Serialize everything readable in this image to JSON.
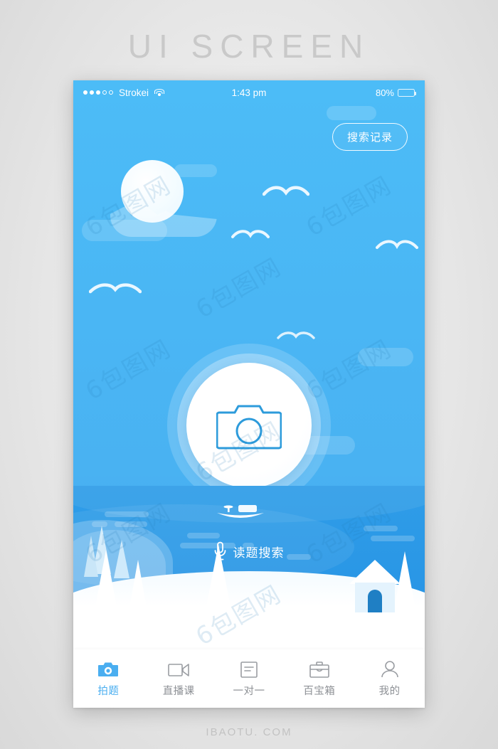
{
  "page": {
    "title": "UI  SCREEN",
    "footer": "IBAOTU. COM",
    "watermark": "6包图网"
  },
  "status_bar": {
    "carrier": "Strokei",
    "signal_filled": 3,
    "signal_hollow": 2,
    "time": "1:43 pm",
    "battery_percent": "80%",
    "battery_level": 80,
    "wifi_icon": "wifi-icon"
  },
  "header": {
    "search_history_label": "搜索记录"
  },
  "main": {
    "camera_button_icon": "camera-icon",
    "voice_search_label": "读题搜索",
    "voice_icon": "microphone-icon"
  },
  "tabbar": {
    "items": [
      {
        "label": "拍题",
        "icon": "camera-icon",
        "active": true
      },
      {
        "label": "直播课",
        "icon": "video-icon",
        "active": false
      },
      {
        "label": "一对一",
        "icon": "document-icon",
        "active": false
      },
      {
        "label": "百宝箱",
        "icon": "briefcase-icon",
        "active": false
      },
      {
        "label": "我的",
        "icon": "person-icon",
        "active": false
      }
    ]
  },
  "colors": {
    "sky": "#4ab8f5",
    "water": "#2f9de8",
    "accent": "#4aaef0",
    "tab_inactive": "#8d9095",
    "snow": "#ffffff",
    "page_bg": "#eaeaea",
    "title_gray": "#c9c9c9"
  },
  "scene": {
    "description": "winter lake scene",
    "elements": [
      "pine-trees",
      "house",
      "boat",
      "snow-hill",
      "clouds"
    ]
  }
}
